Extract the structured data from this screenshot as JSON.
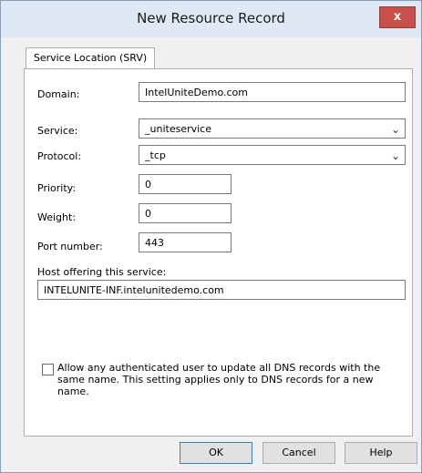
{
  "window": {
    "title": "New Resource Record",
    "close_glyph": "x"
  },
  "tabs": [
    {
      "label": "Service Location (SRV)"
    }
  ],
  "form": {
    "domain_label": "Domain:",
    "domain_value": "IntelUniteDemo.com",
    "service_label": "Service:",
    "service_value": "_uniteservice",
    "protocol_label": "Protocol:",
    "protocol_value": "_tcp",
    "priority_label": "Priority:",
    "priority_value": "0",
    "weight_label": "Weight:",
    "weight_value": "0",
    "port_label": "Port number:",
    "port_value": "443",
    "host_label": "Host offering this service:",
    "host_value": "INTELUNITE-INF.intelunitedemo.com",
    "allow_update_text": "Allow any authenticated user to update all DNS records with the same name. This setting applies only to DNS records for a new name.",
    "allow_update_checked": false
  },
  "buttons": {
    "ok": "OK",
    "cancel": "Cancel",
    "help": "Help"
  },
  "icons": {
    "dropdown": "chevron-down-icon",
    "close": "close-icon"
  },
  "colors": {
    "close_button": "#c7504a",
    "title_bar": "#dfe9f5",
    "dialog_bg": "#f0f0f0"
  }
}
